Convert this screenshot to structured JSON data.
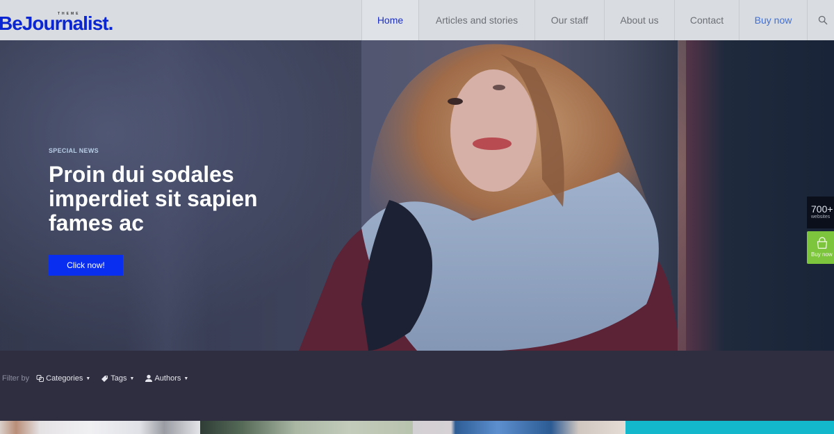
{
  "header": {
    "logo": {
      "main": "BeJournalist.",
      "sub": "THEME"
    },
    "nav": [
      {
        "label": "Home",
        "active": true
      },
      {
        "label": "Articles and stories",
        "active": false
      },
      {
        "label": "Our staff",
        "active": false
      },
      {
        "label": "About us",
        "active": false
      },
      {
        "label": "Contact",
        "active": false
      },
      {
        "label": "Buy now",
        "active": false
      }
    ],
    "search_icon": "search-icon"
  },
  "hero": {
    "kicker": "SPECIAL NEWS",
    "title": "Proin dui sodales imperdiet sit sapien fames ac",
    "cta_label": "Click now!"
  },
  "side_widgets": {
    "count": {
      "number": "700+",
      "label": "websites"
    },
    "buy": {
      "icon": "shopping-bag-icon",
      "label": "Buy now"
    }
  },
  "filter_bar": {
    "label": "Filter by",
    "filters": [
      {
        "label": "Categories",
        "icon": "categories-icon"
      },
      {
        "label": "Tags",
        "icon": "tag-icon"
      },
      {
        "label": "Authors",
        "icon": "user-icon"
      }
    ]
  },
  "colors": {
    "brand_blue": "#0a25d2",
    "cta_blue": "#0a2ef0",
    "buy_green": "#7ec53e",
    "filter_bar_bg": "#2e2e40",
    "header_bg": "#d9dce0"
  }
}
